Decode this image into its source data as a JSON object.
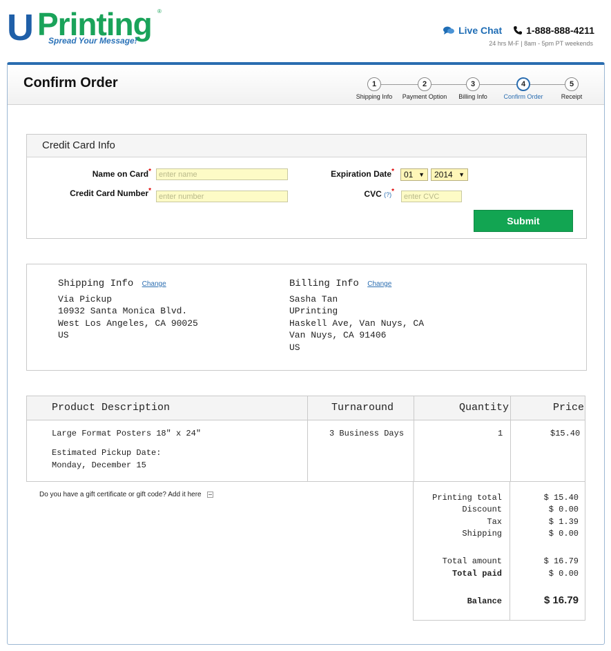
{
  "header": {
    "logo_u": "U",
    "logo_word": "Printing",
    "logo_reg": "®",
    "tagline": "Spread Your Message!",
    "live_chat": "Live Chat",
    "phone": "1-888-888-4211",
    "hours": "24 hrs M-F | 8am - 5pm PT weekends"
  },
  "page": {
    "title": "Confirm Order"
  },
  "steps": [
    {
      "number": "1",
      "label": "Shipping Info"
    },
    {
      "number": "2",
      "label": "Payment Option"
    },
    {
      "number": "3",
      "label": "Billing Info"
    },
    {
      "number": "4",
      "label": "Confirm Order",
      "active": true
    },
    {
      "number": "5",
      "label": "Receipt"
    }
  ],
  "credit_card": {
    "heading": "Credit Card Info",
    "name_label": "Name on Card",
    "name_placeholder": "enter name",
    "number_label": "Credit Card Number",
    "number_placeholder": "enter number",
    "expiration_label": "Expiration Date",
    "exp_month": "01",
    "exp_year": "2014",
    "cvc_label": "CVC",
    "cvc_help": "(?)",
    "cvc_placeholder": "enter CVC",
    "required_mark": "*",
    "submit_label": "Submit"
  },
  "shipping": {
    "title": "Shipping Info",
    "change": "Change",
    "lines": [
      "Via Pickup",
      "10932 Santa Monica Blvd.",
      "West Los Angeles, CA 90025",
      "US"
    ]
  },
  "billing": {
    "title": "Billing Info",
    "change": "Change",
    "lines": [
      "Sasha Tan",
      "UPrinting",
      "Haskell Ave, Van Nuys, CA",
      "Van Nuys, CA 91406",
      "US"
    ]
  },
  "order": {
    "headers": {
      "product": "Product Description",
      "turnaround": "Turnaround",
      "quantity": "Quantity",
      "price": "Price"
    },
    "item": {
      "product": "Large Format Posters 18\" x 24\"",
      "pickup_label": "Estimated Pickup Date:",
      "pickup_date": "Monday, December 15",
      "turnaround": "3 Business Days",
      "quantity": "1",
      "price": "$15.40"
    },
    "gift_text": "Do you have a gift certificate or gift code? Add it here"
  },
  "totals": {
    "printing_total_label": "Printing total",
    "printing_total": "$ 15.40",
    "discount_label": "Discount",
    "discount": "$ 0.00",
    "tax_label": "Tax",
    "tax": "$ 1.39",
    "shipping_label": "Shipping",
    "shipping": "$ 0.00",
    "total_amount_label": "Total amount",
    "total_amount": "$ 16.79",
    "total_paid_label": "Total paid",
    "total_paid": "$ 0.00",
    "balance_label": "Balance",
    "balance": "$ 16.79"
  },
  "colors": {
    "brand_blue": "#1f5fa8",
    "brand_green": "#1aa35a",
    "submit_green": "#12a552",
    "input_yellow": "#fdfbc6",
    "link_blue": "#2a6db0"
  }
}
